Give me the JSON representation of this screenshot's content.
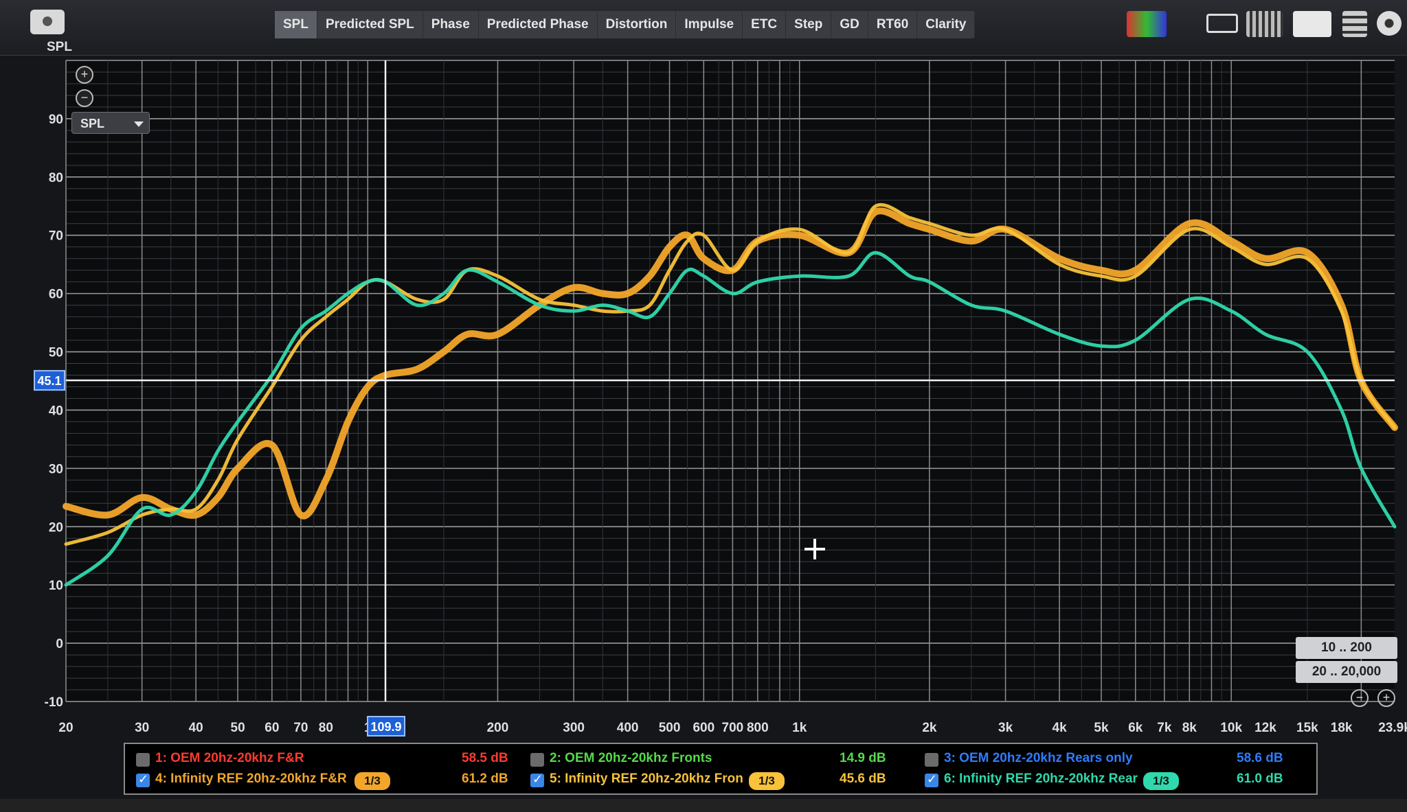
{
  "toolbar": {
    "tabs": [
      "SPL",
      "Predicted SPL",
      "Phase",
      "Predicted Phase",
      "Distortion",
      "Impulse",
      "ETC",
      "Step",
      "GD",
      "RT60",
      "Clarity"
    ],
    "active_tab": "SPL",
    "icons": [
      "camera-icon",
      "overlay-icon",
      "single-view-icon",
      "multi-view-icon",
      "fit-view-icon",
      "stack-view-icon",
      "settings-icon"
    ]
  },
  "panel": {
    "y_unit": "SPL",
    "selector": "SPL",
    "cursor_y_value": "45.1",
    "cursor_x_value": "109.9",
    "range_buttons": [
      "10 .. 200",
      "20 .. 20,000"
    ]
  },
  "chart_data": {
    "type": "line",
    "x_scale": "log",
    "xlim": [
      20,
      23900
    ],
    "ylim": [
      -10,
      100
    ],
    "grid": true,
    "ylabel": "SPL",
    "y_ticks": [
      "90",
      "80",
      "70",
      "60",
      "50",
      "40",
      "30",
      "20",
      "10",
      "0",
      "-10"
    ],
    "x_ticks": [
      "20",
      "30",
      "40",
      "50",
      "60",
      "70",
      "80",
      "1",
      "200",
      "300",
      "400",
      "500",
      "600",
      "700",
      "800",
      "1k",
      "2k",
      "3k",
      "4k",
      "5k",
      "6k",
      "7k",
      "8k",
      "10k",
      "12k",
      "15k",
      "18k",
      "23.9k"
    ],
    "x_tick_values": [
      20,
      30,
      40,
      50,
      60,
      70,
      80,
      100,
      200,
      300,
      400,
      500,
      600,
      700,
      800,
      1000,
      2000,
      3000,
      4000,
      5000,
      6000,
      7000,
      8000,
      10000,
      12000,
      15000,
      18000,
      23900
    ],
    "cursor": {
      "x": 109.9,
      "y": 45.1
    },
    "x": [
      20,
      25,
      30,
      35,
      40,
      45,
      50,
      60,
      70,
      80,
      90,
      100,
      110,
      130,
      150,
      170,
      200,
      250,
      300,
      350,
      400,
      450,
      500,
      550,
      600,
      700,
      800,
      1000,
      1300,
      1500,
      1800,
      2000,
      2500,
      3000,
      4000,
      5000,
      6000,
      8000,
      10000,
      12000,
      15000,
      18000,
      20000,
      23900
    ],
    "series": [
      {
        "name": "4: Infinity REF 20hz-20khz F&R",
        "color": "#f3a62a",
        "values": [
          23.5,
          22,
          25,
          23,
          22,
          25,
          30,
          34,
          22,
          28,
          38,
          44,
          46,
          47,
          50,
          53,
          53,
          58,
          61,
          60,
          60,
          63,
          68,
          70,
          66,
          64,
          69,
          70,
          67,
          74,
          72,
          71,
          69,
          71,
          66,
          64,
          64,
          72,
          69,
          66,
          67,
          58,
          45,
          37
        ],
        "width": 10
      },
      {
        "name": "5: Infinity REF 20hz-20khz Fron",
        "color": "#f8c23a",
        "values": [
          17,
          19,
          22,
          23,
          23,
          28,
          35,
          44,
          52,
          56,
          59,
          62,
          62,
          59,
          59,
          64,
          63,
          59,
          58,
          57,
          57,
          58,
          64,
          69,
          70,
          64,
          69,
          71,
          67,
          75,
          73,
          72,
          70,
          71,
          65,
          63,
          63,
          71,
          68,
          65,
          66,
          57,
          45,
          37
        ],
        "width": 5
      },
      {
        "name": "6: Infinity REF 20hz-20khz Rear",
        "color": "#2fd9ad",
        "values": [
          10,
          15,
          23,
          22,
          26,
          33,
          38,
          46,
          54,
          57,
          60,
          62,
          62,
          58,
          60,
          64,
          62,
          58,
          57,
          58,
          57,
          56,
          60,
          64,
          63,
          60,
          62,
          63,
          63,
          67,
          63,
          62,
          58,
          57,
          53,
          51,
          52,
          59,
          57,
          53,
          50,
          40,
          30,
          20
        ],
        "width": 5
      }
    ]
  },
  "legend": [
    {
      "label": "1: OEM 20hz-20khz F&R",
      "value": "58.5 dB",
      "color": "#ff3b2f",
      "checked": false,
      "smoothing": ""
    },
    {
      "label": "2: OEM 20hz-20khz Fronts",
      "value": "14.9 dB",
      "color": "#56d94b",
      "checked": false,
      "smoothing": ""
    },
    {
      "label": "3: OEM 20hz-20khz Rears only",
      "value": "58.6 dB",
      "color": "#2f7cff",
      "checked": false,
      "smoothing": ""
    },
    {
      "label": "4: Infinity REF 20hz-20khz F&R",
      "value": "61.2 dB",
      "color": "#f3a62a",
      "checked": true,
      "smoothing": "1/3"
    },
    {
      "label": "5: Infinity REF 20hz-20khz Fron",
      "value": "45.6 dB",
      "color": "#f8c23a",
      "checked": true,
      "smoothing": "1/3"
    },
    {
      "label": "6: Infinity REF 20hz-20khz Rear",
      "value": "61.0 dB",
      "color": "#2fd9ad",
      "checked": true,
      "smoothing": "1/3"
    }
  ]
}
